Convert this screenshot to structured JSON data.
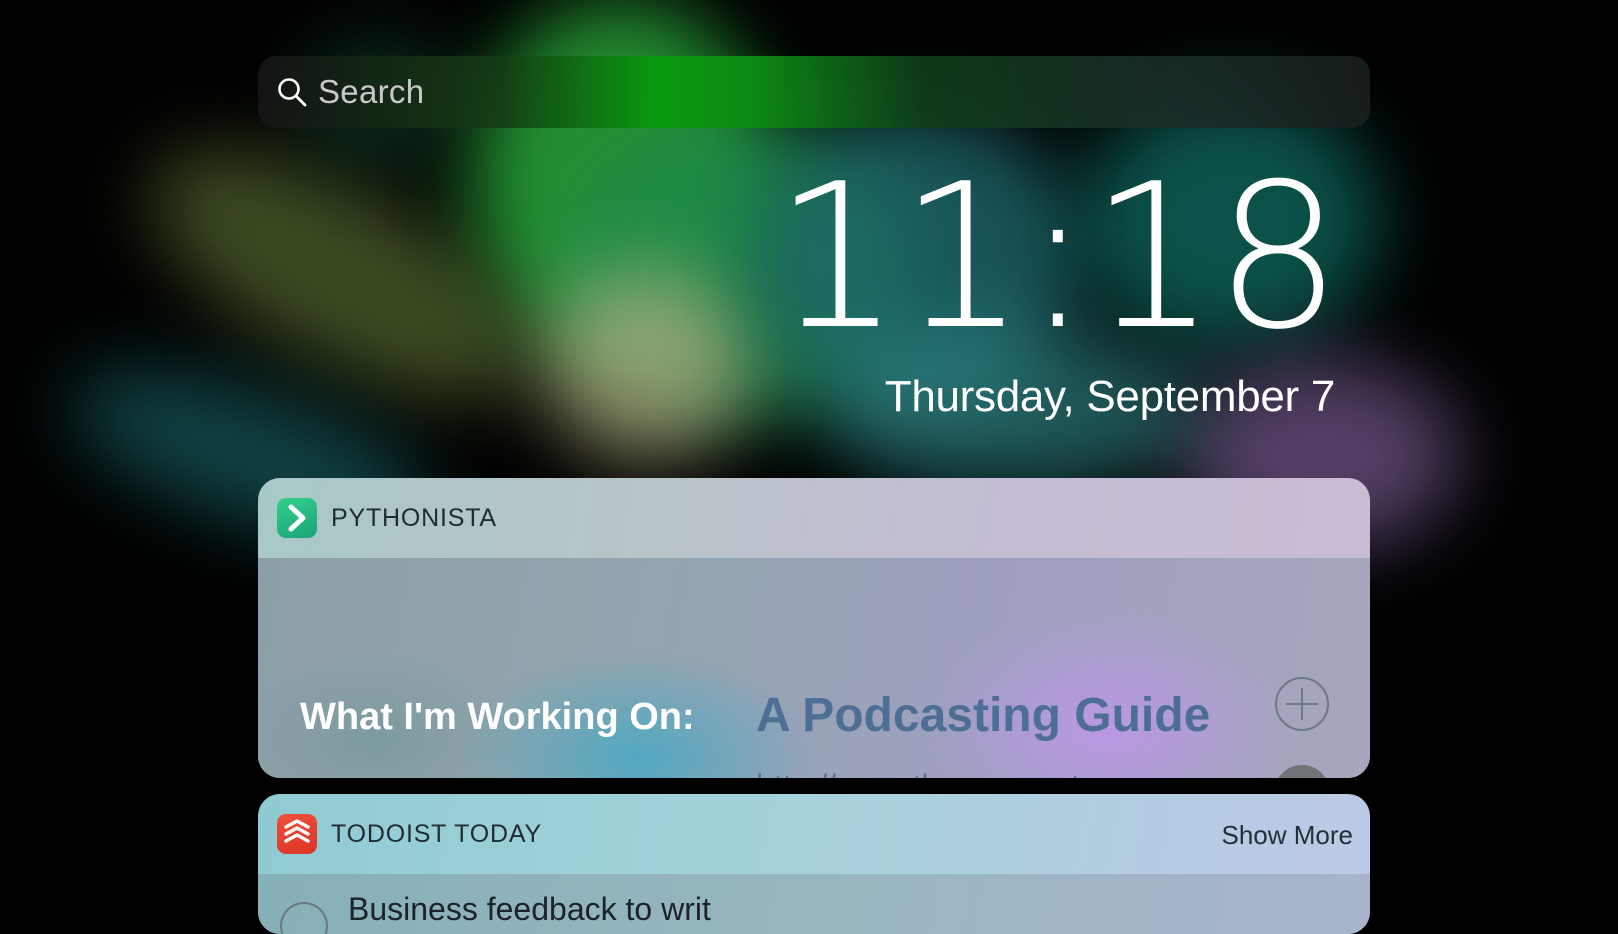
{
  "search": {
    "placeholder": "Search",
    "icon": "search-icon"
  },
  "clock": {
    "time": "11:18",
    "date": "Thursday, September 7"
  },
  "widgets": {
    "pythonista": {
      "app_name": "PYTHONISTA",
      "icon": "pythonista-app-icon",
      "label": "What I'm Working On:",
      "title": "A Podcasting Guide",
      "url": "http://www.thecope.net",
      "actions": [
        "add-icon",
        "check-icon"
      ]
    },
    "todoist": {
      "app_name": "TODOIST TODAY",
      "icon": "todoist-app-icon",
      "show_more": "Show More",
      "first_task": "Business feedback to writ"
    }
  },
  "colors": {
    "link_blue": "#4e6f95",
    "todoist_red": "#e0402e",
    "pythonista_green": "#26b883"
  }
}
